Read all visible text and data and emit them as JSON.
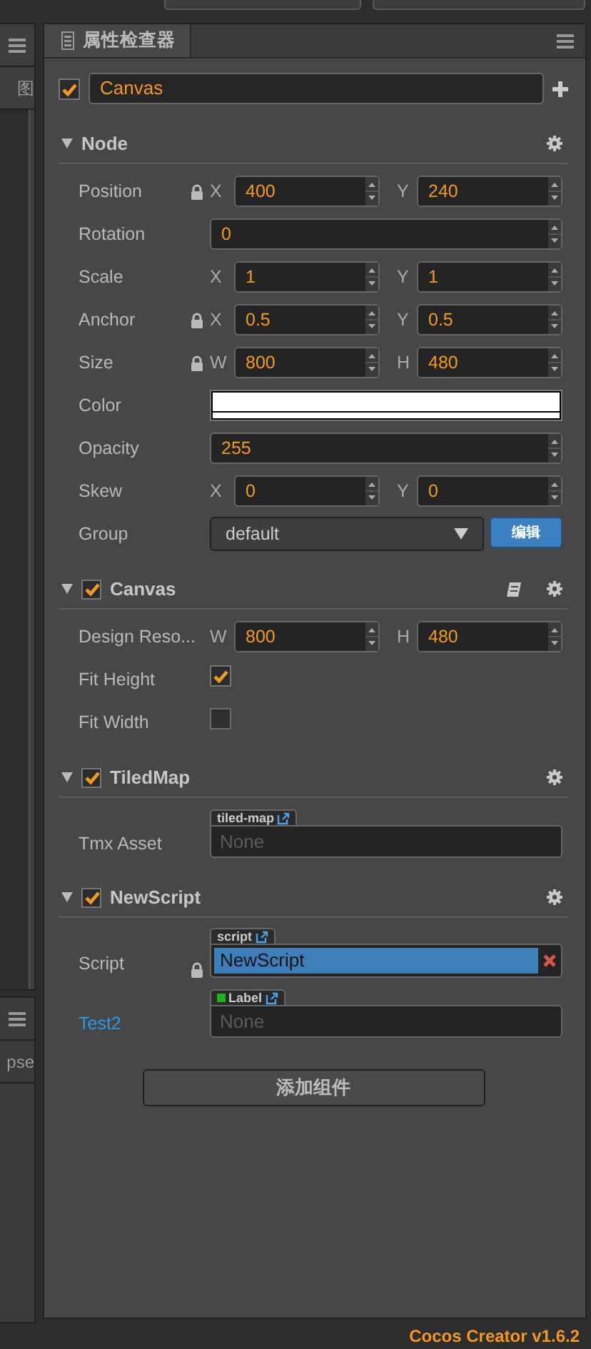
{
  "left_panel": {
    "header_text": "图",
    "lower_text": "pse"
  },
  "inspector": {
    "tab": {
      "title": "属性检查器",
      "selected": true
    },
    "node": {
      "active": true,
      "name": "Canvas"
    },
    "components": [
      {
        "kind": "node",
        "title": "Node",
        "help": false,
        "properties": [
          {
            "kind": "vec2",
            "label": "Position",
            "locked": true,
            "axes": [
              {
                "axis": "X",
                "value": "400"
              },
              {
                "axis": "Y",
                "value": "240"
              }
            ]
          },
          {
            "kind": "number",
            "label": "Rotation",
            "locked": false,
            "value": "0"
          },
          {
            "kind": "vec2",
            "label": "Scale",
            "locked": false,
            "axes": [
              {
                "axis": "X",
                "value": "1"
              },
              {
                "axis": "Y",
                "value": "1"
              }
            ]
          },
          {
            "kind": "vec2",
            "label": "Anchor",
            "locked": true,
            "axes": [
              {
                "axis": "X",
                "value": "0.5"
              },
              {
                "axis": "Y",
                "value": "0.5"
              }
            ]
          },
          {
            "kind": "vec2",
            "label": "Size",
            "locked": true,
            "axes": [
              {
                "axis": "W",
                "value": "800"
              },
              {
                "axis": "H",
                "value": "480"
              }
            ]
          },
          {
            "kind": "color",
            "label": "Color",
            "locked": false,
            "color": "#ffffff"
          },
          {
            "kind": "number",
            "label": "Opacity",
            "locked": false,
            "value": "255"
          },
          {
            "kind": "vec2",
            "label": "Skew",
            "locked": false,
            "axes": [
              {
                "axis": "X",
                "value": "0"
              },
              {
                "axis": "Y",
                "value": "0"
              }
            ]
          },
          {
            "kind": "dropdown",
            "label": "Group",
            "locked": false,
            "value": "default",
            "button": "编辑"
          }
        ]
      },
      {
        "kind": "component",
        "title": "Canvas",
        "enabled": true,
        "help": true,
        "properties": [
          {
            "kind": "vec2",
            "label": "Design Reso...",
            "locked": false,
            "axes": [
              {
                "axis": "W",
                "value": "800"
              },
              {
                "axis": "H",
                "value": "480"
              }
            ]
          },
          {
            "kind": "checkbox",
            "label": "Fit Height",
            "locked": false,
            "checked": true
          },
          {
            "kind": "checkbox",
            "label": "Fit Width",
            "locked": false,
            "checked": false
          }
        ]
      },
      {
        "kind": "component",
        "title": "TiledMap",
        "enabled": true,
        "help": false,
        "properties": [
          {
            "kind": "asset",
            "label": "Tmx Asset",
            "locked": false,
            "link": false,
            "tag": "tiled-map",
            "tag_dot": false,
            "placeholder": "None"
          }
        ]
      },
      {
        "kind": "component",
        "title": "NewScript",
        "enabled": true,
        "help": false,
        "properties": [
          {
            "kind": "script",
            "label": "Script",
            "locked": true,
            "tag": "script",
            "value": "NewScript"
          },
          {
            "kind": "asset",
            "label": "Test2",
            "locked": false,
            "link": true,
            "tag": "Label",
            "tag_dot": true,
            "placeholder": "None"
          }
        ]
      }
    ],
    "add_button": "添加组件"
  },
  "status_bar": {
    "version": "Cocos Creator v1.6.2"
  }
}
